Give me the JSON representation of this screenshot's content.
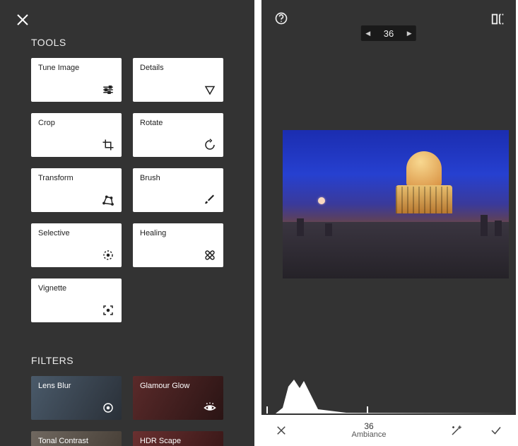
{
  "left": {
    "tools_header": "TOOLS",
    "tools": [
      {
        "label": "Tune Image",
        "icon": "sliders"
      },
      {
        "label": "Details",
        "icon": "triangle-down"
      },
      {
        "label": "Crop",
        "icon": "crop"
      },
      {
        "label": "Rotate",
        "icon": "rotate"
      },
      {
        "label": "Transform",
        "icon": "transform"
      },
      {
        "label": "Brush",
        "icon": "brush"
      },
      {
        "label": "Selective",
        "icon": "target-dashed"
      },
      {
        "label": "Healing",
        "icon": "bandage"
      },
      {
        "label": "Vignette",
        "icon": "focus-square"
      }
    ],
    "filters_header": "FILTERS",
    "filters": [
      {
        "label": "Lens Blur",
        "icon": "dot-circle",
        "bg": "linear-gradient(120deg,#4a5a6a,#2a3038)"
      },
      {
        "label": "Glamour Glow",
        "icon": "eye",
        "bg": "linear-gradient(120deg,#5a2a2a,#2a1414)"
      },
      {
        "label": "Tonal Contrast",
        "icon": "",
        "bg": "linear-gradient(120deg,#706860,#484038)"
      },
      {
        "label": "HDR Scape",
        "icon": "",
        "bg": "linear-gradient(120deg,#6a3030,#3a1818)"
      }
    ]
  },
  "right": {
    "pill_value": "36",
    "bottom": {
      "value": "36",
      "param": "Ambiance"
    }
  }
}
